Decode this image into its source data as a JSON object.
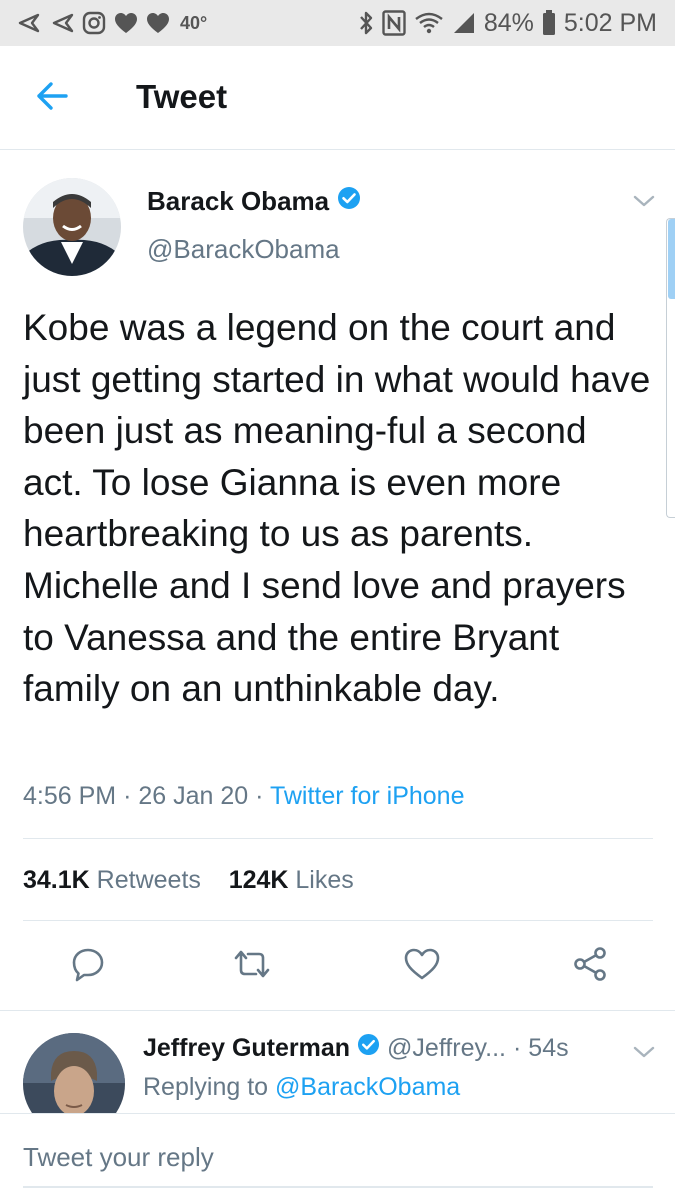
{
  "status_bar": {
    "temperature": "40°",
    "battery": "84%",
    "time": "5:02 PM",
    "left_icons": [
      "back-arrow-icon",
      "back-arrow-icon",
      "instagram-icon",
      "heart-icon",
      "heart-icon"
    ],
    "right_icons": [
      "bluetooth-icon",
      "nfc-icon",
      "wifi-icon",
      "signal-icon",
      "battery-icon"
    ]
  },
  "header": {
    "title": "Tweet"
  },
  "tweet": {
    "author_name": "Barack Obama",
    "author_handle": "@BarackObama",
    "verified": true,
    "text": "Kobe was a legend on the court and just getting started in what would have been just as meaning-ful a second act. To lose Gianna is even more heartbreaking to us as parents. Michelle and I send love and prayers to Vanessa and the entire Bryant family on an unthinkable day.",
    "time": "4:56 PM",
    "date": "26 Jan 20",
    "source": "Twitter for iPhone",
    "retweets_count": "34.1K",
    "retweets_label": "Retweets",
    "likes_count": "124K",
    "likes_label": "Likes"
  },
  "reply": {
    "author_name": "Jeffrey Guterman",
    "author_handle": "@Jeffrey...",
    "verified": true,
    "time": "54s",
    "replying_prefix": "Replying to",
    "replying_to": "@BarackObama"
  },
  "composer": {
    "placeholder": "Tweet your reply"
  },
  "colors": {
    "accent": "#1da1f2",
    "text": "#14171a",
    "secondary_text": "#657786",
    "status_bar_bg": "#e9e9e9",
    "divider": "#e1e8ed"
  }
}
